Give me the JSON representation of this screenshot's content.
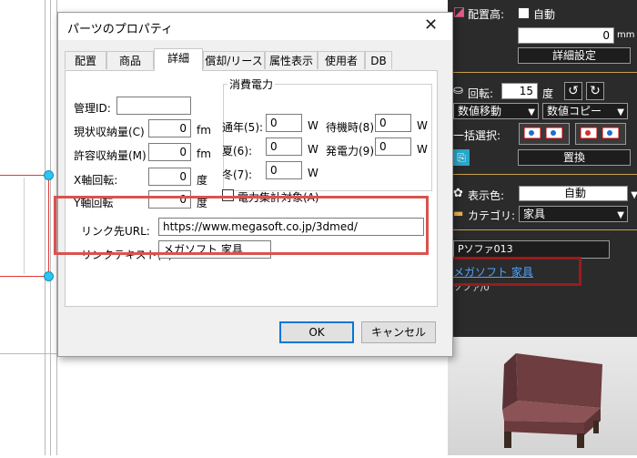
{
  "dialog": {
    "title": "パーツのプロパティ",
    "close_glyph": "✕",
    "tabs": [
      "配置",
      "商品",
      "詳細",
      "償却/リース",
      "属性表示",
      "使用者",
      "DB"
    ],
    "active_tab": "詳細",
    "fields": {
      "management_id": {
        "label": "管理ID:",
        "value": ""
      },
      "current_storage": {
        "label": "現状収納量(C)",
        "value": "0",
        "unit": "fm"
      },
      "allowed_storage": {
        "label": "許容収納量(M)",
        "value": "0",
        "unit": "fm"
      },
      "x_rotation": {
        "label": "X軸回転:",
        "value": "0",
        "unit": "度"
      },
      "y_rotation": {
        "label": "Y軸回転",
        "value": "0",
        "unit": "度"
      }
    },
    "power": {
      "group_title": "消費電力",
      "normal": {
        "label": "通年(5):",
        "value": "0",
        "unit": "W"
      },
      "standby": {
        "label": "待機時(8)",
        "value": "0",
        "unit": "W"
      },
      "summer": {
        "label": "夏(6):",
        "value": "0",
        "unit": "W"
      },
      "generation": {
        "label": "発電力(9)",
        "value": "0",
        "unit": "W"
      },
      "winter": {
        "label": "冬(7):",
        "value": "0",
        "unit": "W"
      },
      "aggregate_label": "電力集計対象(A)"
    },
    "link": {
      "url_label": "リンク先URL:",
      "url_value": "https://www.megasoft.co.jp/3dmed/",
      "text_label": "リンクテキスト(T):",
      "text_value": "メガソフト 家具"
    },
    "ok_label": "OK",
    "cancel_label": "キャンセル"
  },
  "right_panel": {
    "height_label": "配置高:",
    "auto_label": "自動",
    "height_value": "0",
    "height_unit": "mm",
    "detail_button": "詳細設定",
    "rotation_label": "回転:",
    "rotation_value": "15",
    "rotation_unit": "度",
    "numeric_move": "数値移動",
    "numeric_copy": "数値コピー",
    "bulk_select_label": "一括選択:",
    "replace_button": "置換",
    "display_color_label": "表示色:",
    "display_color_value": "自動",
    "category_label": "カテゴリ:",
    "category_value": "家具",
    "part_name": "Pソファ013",
    "link_text": "メガソフト 家具",
    "sub_text": "ソファ/0"
  },
  "colors": {
    "highlight_red": "#d9534f",
    "highlight_dark_red": "#9b1b1b",
    "panel_bg": "#2b2b2b",
    "accent_gold": "#c8a24a",
    "link_blue": "#4fa3ff",
    "chair": "#7a4648"
  }
}
